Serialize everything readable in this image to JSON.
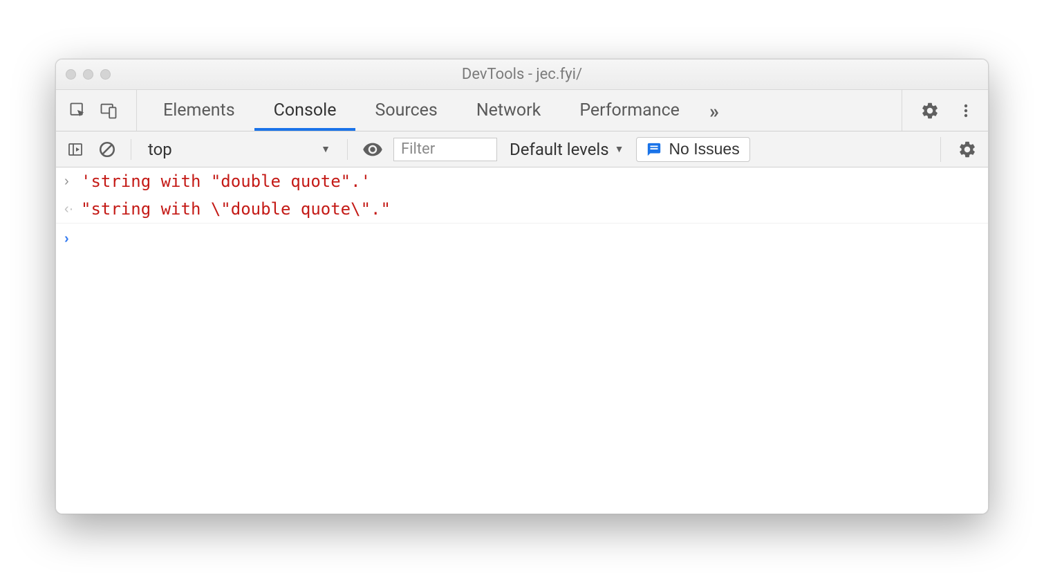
{
  "window": {
    "title": "DevTools - jec.fyi/"
  },
  "tabs": {
    "elements": "Elements",
    "console": "Console",
    "sources": "Sources",
    "network": "Network",
    "performance": "Performance"
  },
  "subbar": {
    "context": "top",
    "filter_placeholder": "Filter",
    "levels_label": "Default levels",
    "issues_label": "No Issues"
  },
  "console": {
    "input_line": "'string with \"double quote\".'",
    "output_line": "\"string with \\\"double quote\\\".\""
  }
}
